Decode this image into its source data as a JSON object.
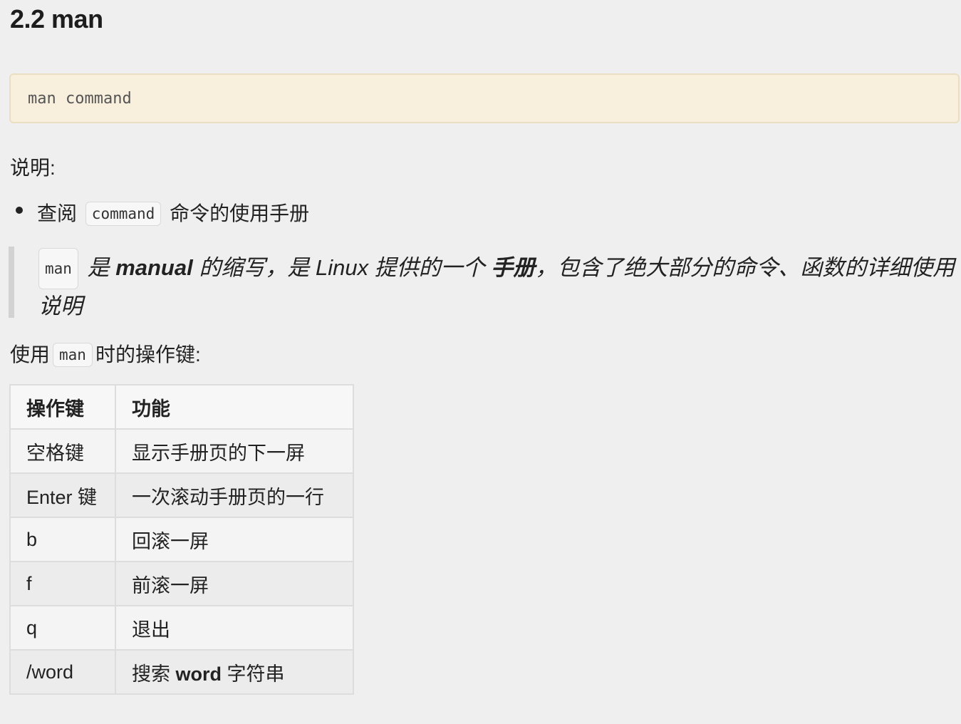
{
  "section": {
    "title": "2.2 man"
  },
  "code_block": {
    "code": "man command"
  },
  "description": {
    "label": "说明:",
    "bullets": [
      {
        "before": "查阅",
        "code": "command",
        "after": "命令的使用手册"
      }
    ]
  },
  "quote": {
    "code": "man",
    "part1": "是",
    "bold1": "manual",
    "part2": "的缩写，是 Linux 提供的一个",
    "bold2": "手册",
    "part3": "，包含了绝大部分的命令、函数的详细使用说明"
  },
  "operations": {
    "before": "使用",
    "code": "man",
    "after": "时的操作键:"
  },
  "table": {
    "headers": [
      "操作键",
      "功能"
    ],
    "rows": [
      {
        "key": "空格键",
        "function": "显示手册页的下一屏"
      },
      {
        "key": "Enter 键",
        "function": "一次滚动手册页的一行"
      },
      {
        "key": "b",
        "function": "回滚一屏"
      },
      {
        "key": "f",
        "function": "前滚一屏"
      },
      {
        "key": "q",
        "function": "退出"
      },
      {
        "key": "/word",
        "function_before": "搜索",
        "function_bold": "word",
        "function_after": "字符串"
      }
    ]
  }
}
